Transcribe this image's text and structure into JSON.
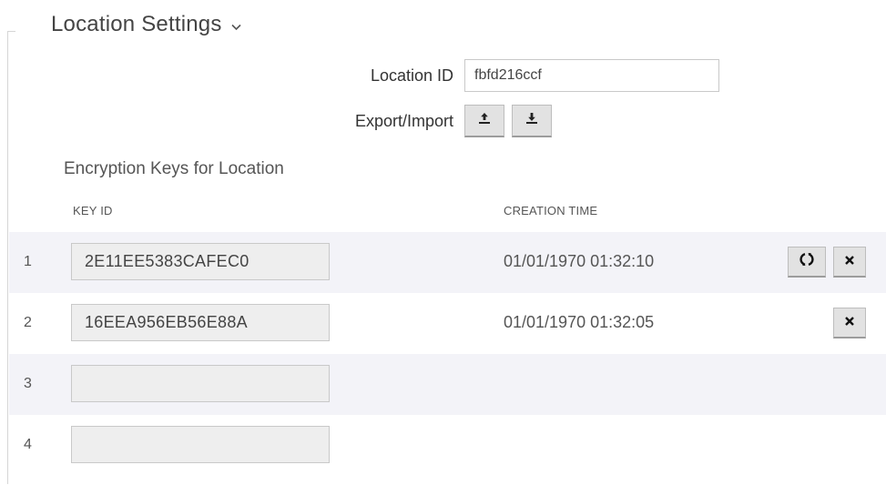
{
  "section": {
    "title": "Location Settings",
    "chevron_icon": "chevron-down-icon"
  },
  "location": {
    "label": "Location ID",
    "value": "fbfd216ccf"
  },
  "export_import": {
    "label": "Export/Import",
    "export_icon": "upload-icon",
    "import_icon": "download-icon"
  },
  "keys": {
    "title": "Encryption Keys for Location",
    "headers": {
      "key_id": "KEY ID",
      "creation_time": "CREATION TIME"
    },
    "rows": [
      {
        "index": "1",
        "key_id": "2E11EE5383CAFEC0",
        "creation_time": "01/01/1970 01:32:10",
        "actions": [
          "refresh",
          "delete"
        ]
      },
      {
        "index": "2",
        "key_id": "16EEA956EB56E88A",
        "creation_time": "01/01/1970 01:32:05",
        "actions": [
          "delete"
        ]
      },
      {
        "index": "3",
        "key_id": "",
        "creation_time": "",
        "actions": []
      },
      {
        "index": "4",
        "key_id": "",
        "creation_time": "",
        "actions": []
      }
    ]
  },
  "colors": {
    "row_stripe": "#f3f3f8",
    "button_bg": "#e2e2e2",
    "field_bg": "#eeeeee"
  }
}
